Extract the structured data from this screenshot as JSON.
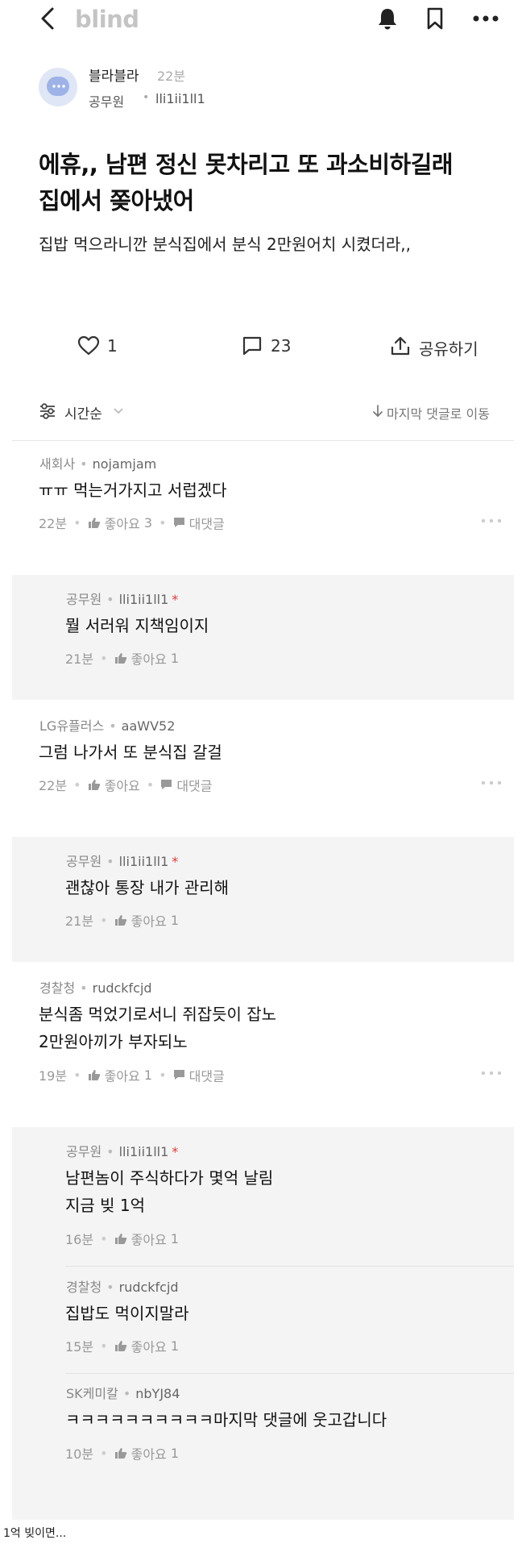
{
  "app": {
    "brand": "blind"
  },
  "author": {
    "name": "블라블라",
    "time": "22분",
    "company": "공무원",
    "id": "lli1ii1ll1"
  },
  "post": {
    "title_line1": "에휴,, 남편 정신 못차리고 또 과소비하길래",
    "title_line2": "집에서 쫒아냈어",
    "body": "집밥 먹으라니깐 분식집에서 분식 2만원어치 시켰더라,,"
  },
  "actions": {
    "likes": "1",
    "comments": "23",
    "share": "공유하기"
  },
  "sort": {
    "label": "시간순",
    "jump": "마지막 댓글로 이동"
  },
  "labels": {
    "like": "좋아요",
    "reply": "대댓글"
  },
  "comments": [
    {
      "company": "새회사",
      "id": "nojamjam",
      "text": "ㅠㅠ 먹는거가지고 서럽겠다",
      "time": "22분",
      "likes": "3"
    },
    {
      "company": "공무원",
      "id": "lli1ii1ll1",
      "text": "뭘 서러워 지책임이지",
      "time": "21분",
      "likes": "1"
    },
    {
      "company": "LG유플러스",
      "id": "aaWV52",
      "text": "그럼 나가서 또 분식집 갈걸",
      "time": "22분",
      "likes": ""
    },
    {
      "company": "공무원",
      "id": "lli1ii1ll1",
      "text": "괜찮아 통장 내가 관리해",
      "time": "21분",
      "likes": "1"
    },
    {
      "company": "경찰청",
      "id": "rudckfcjd",
      "text_line1": "분식좀 먹었기로서니 쥐잡듯이 잡노",
      "text_line2": "2만원아끼가 부자되노",
      "time": "19분",
      "likes": "1"
    },
    {
      "company": "공무원",
      "id": "lli1ii1ll1",
      "text_line1": "남편놈이 주식하다가 몇억 날림",
      "text_line2": "지금 빚 1억",
      "time": "16분",
      "likes": "1"
    },
    {
      "company": "경찰청",
      "id": "rudckfcjd",
      "text": "집밥도 먹이지말라",
      "time": "15분",
      "likes": "1"
    },
    {
      "company": "SK케미칼",
      "id": "nbYJ84",
      "text": "ㅋㅋㅋㅋㅋㅋㅋㅋㅋㅋ마지막 댓글에 웃고갑니다",
      "time": "10분",
      "likes": "1"
    }
  ],
  "caption": "1억 빚이면...",
  "colors": {
    "brand_gray": "#c4c4c4",
    "author_star": "#e33333",
    "reply_bg": "#f4f4f4",
    "avatar_bg": "#dfe6f5",
    "avatar_bubble": "#9db3e8"
  },
  "icons": [
    "chevron-left-icon",
    "bell-icon",
    "bookmark-icon",
    "more-icon",
    "heart-icon",
    "comment-icon",
    "share-icon",
    "sort-icon",
    "chevron-down-icon",
    "arrow-down-icon",
    "thumbs-up-icon",
    "reply-bubble-icon"
  ]
}
